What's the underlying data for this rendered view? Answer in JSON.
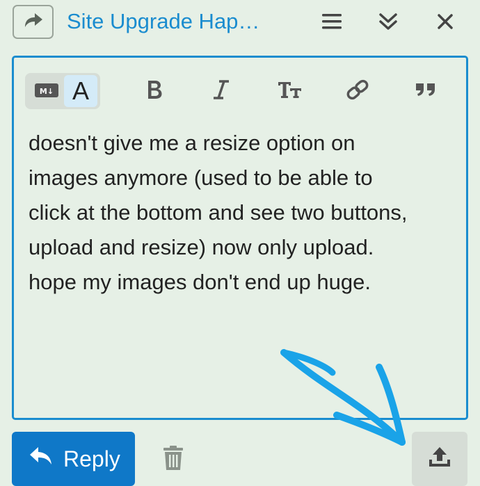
{
  "header": {
    "title": "Site Upgrade Hap…",
    "icons": [
      "share-icon",
      "menu-icon",
      "collapse-icon",
      "close-icon"
    ]
  },
  "toolbar": {
    "markdown_label": "M↓",
    "font_label": "A",
    "tools": [
      "bold-icon",
      "italic-icon",
      "heading-icon",
      "link-icon",
      "quote-icon"
    ]
  },
  "editor": {
    "lines": [
      "doesn't give me a resize option on",
      "images anymore (used to be able to",
      "click at the bottom and see two buttons,",
      "upload and resize) now only upload.",
      "hope my images don't end up huge."
    ]
  },
  "footer": {
    "reply_label": "Reply"
  },
  "colors": {
    "accent": "#1a8ccf",
    "button": "#0f78c8",
    "background": "#e6f0e6",
    "annotation_arrow": "#1aa3e8"
  }
}
